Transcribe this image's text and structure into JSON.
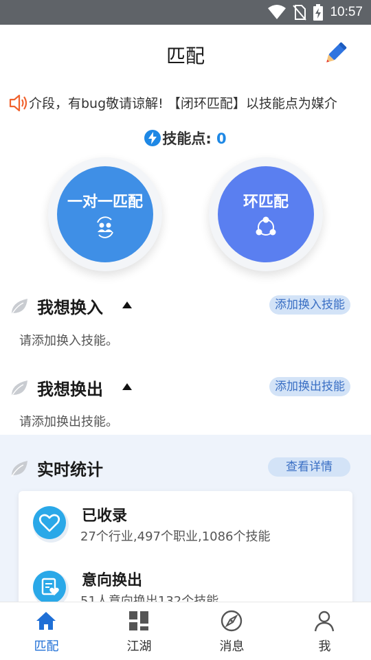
{
  "status_bar": {
    "time": "10:57"
  },
  "header": {
    "title": "匹配"
  },
  "marquee": {
    "text": "介段，有bug敬请谅解! 【闭环匹配】以技能点为媒介"
  },
  "skill_points": {
    "label": "技能点:",
    "value": "0"
  },
  "match_buttons": [
    {
      "label": "一对一匹配",
      "icon": "two-users-swap-icon"
    },
    {
      "label": "环匹配",
      "icon": "ring-network-icon"
    }
  ],
  "want_in": {
    "title": "我想换入",
    "button": "添加换入技能",
    "hint": "请添加换入技能。"
  },
  "want_out": {
    "title": "我想换出",
    "button": "添加换出技能",
    "hint": "请添加换出技能。"
  },
  "stats": {
    "title": "实时统计",
    "button": "查看详情",
    "items": [
      {
        "title": "已收录",
        "sub": "27个行业,497个职业,1086个技能"
      },
      {
        "title": "意向换出",
        "sub": "51人意向换出132个技能"
      }
    ]
  },
  "tabbar": {
    "items": [
      {
        "label": "匹配",
        "active": true
      },
      {
        "label": "江湖",
        "active": false
      },
      {
        "label": "消息",
        "active": false
      },
      {
        "label": "我",
        "active": false
      }
    ]
  },
  "colors": {
    "primary": "#1f6fd6",
    "btn_one": "#3f8fe6",
    "btn_ring": "#5a7ff0",
    "pill_bg": "#d3e3f7",
    "stats_bg": "#eef3fb"
  }
}
